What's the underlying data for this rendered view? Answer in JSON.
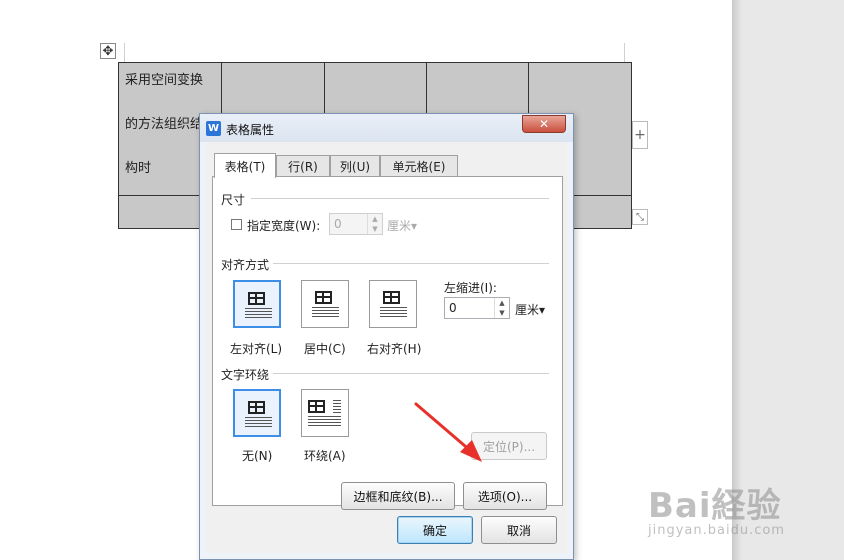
{
  "document": {
    "table_cell_lines": [
      "采用空间变换",
      "的方法组织结",
      "构时"
    ],
    "add_column_symbol": "+",
    "move_handle_symbol": "✥",
    "resize_handle_symbol": "⤡"
  },
  "dialog": {
    "title": "表格属性",
    "app_icon_letter": "W",
    "close_symbol": "✕",
    "tabs": [
      {
        "label": "表格(T)",
        "active": true
      },
      {
        "label": "行(R)",
        "active": false
      },
      {
        "label": "列(U)",
        "active": false
      },
      {
        "label": "单元格(E)",
        "active": false
      }
    ],
    "size": {
      "group_label": "尺寸",
      "width_checkbox_label": "指定宽度(W):",
      "width_value": "0",
      "width_unit": "厘米▾"
    },
    "alignment": {
      "group_label": "对齐方式",
      "options": [
        "左对齐(L)",
        "居中(C)",
        "右对齐(H)"
      ],
      "selected": "左对齐(L)",
      "indent_label": "左缩进(I):",
      "indent_value": "0",
      "indent_unit": "厘米▾"
    },
    "wrapping": {
      "group_label": "文字环绕",
      "options": [
        "无(N)",
        "环绕(A)"
      ],
      "selected": "无(N)"
    },
    "buttons": {
      "position": "定位(P)...",
      "borders_shading": "边框和底纹(B)...",
      "options": "选项(O)...",
      "ok": "确定",
      "cancel": "取消"
    }
  },
  "watermark": {
    "logo": "Bai経验",
    "url": "jingyan.baidu.com"
  },
  "colors": {
    "accent": "#3d8ee6",
    "arrow": "#e8302a",
    "table_fill": "#c8c8c8"
  }
}
